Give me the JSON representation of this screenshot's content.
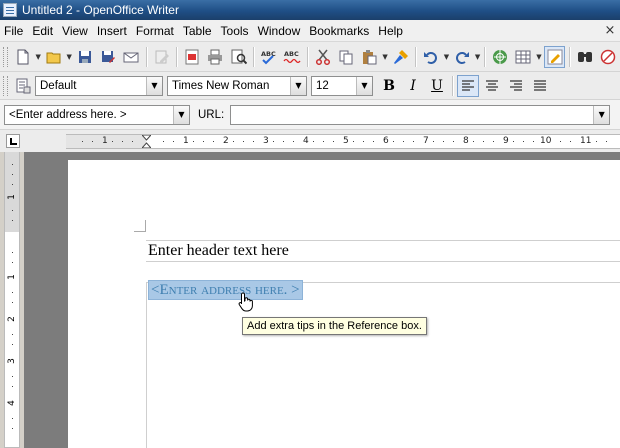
{
  "window": {
    "title": "Untitled 2 - OpenOffice Writer"
  },
  "menubar": {
    "items": [
      "File",
      "Edit",
      "View",
      "Insert",
      "Format",
      "Table",
      "Tools",
      "Window",
      "Bookmarks",
      "Help"
    ],
    "close_glyph": "×"
  },
  "formatting": {
    "style": "Default",
    "font": "Times New Roman",
    "size": "12",
    "bold": "B",
    "italic": "I",
    "underline": "U"
  },
  "fields_bar": {
    "address_value": "<Enter address here. >",
    "url_label": "URL:",
    "url_value": ""
  },
  "ruler": {
    "marks": [
      "1",
      "1",
      "2",
      "3",
      "4",
      "5",
      "6",
      "7",
      "8",
      "9",
      "10",
      "11"
    ],
    "vmarks": [
      "1",
      "1",
      "2",
      "3",
      "4"
    ]
  },
  "document": {
    "header_text": "Enter header text here",
    "address_placeholder": "<Enter address here. >",
    "tooltip": "Add extra tips in the Reference box."
  },
  "colors": {
    "title_bar": "#1f4f86",
    "selection": "#a9c8e6",
    "placeholder_text": "#3f7fb0",
    "tooltip_bg": "#ffffe1"
  }
}
